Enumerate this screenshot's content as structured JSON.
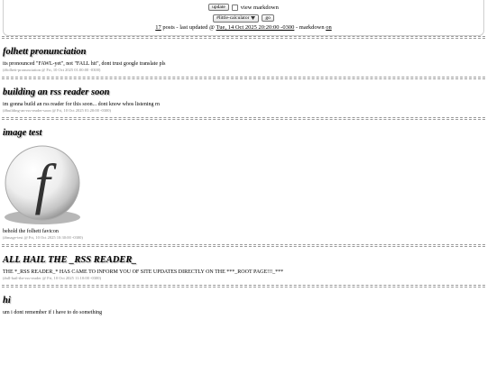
{
  "header": {
    "update_label": "update",
    "view_markdown_label": "view markdown",
    "view_markdown_checked": false,
    "channel_select": "#little-calculator",
    "go_label": "go",
    "status": {
      "post_count": "17",
      "posts_text": " posts - last updated @ ",
      "updated": "Tue, 14 Oct 2025 20:20:00 -0300",
      "markdown_text": " - markdown ",
      "markdown_state": "on"
    }
  },
  "posts": [
    {
      "title": "folhett pronunciation",
      "body": "its pronounced \"FAWL-yet\", not \"FALL hit\", dont trust google translate pls",
      "meta": "(#folhett-pronunciation @ Fri, 10 Oct 2025 01:00:00 -0300)"
    },
    {
      "title": "building an rss reader soon",
      "body": "im gonna build an rss reader for this soon... dont know whos listening rn",
      "meta": "(#building-an-rss-reader-soon @ Fri, 10 Oct 2025 01:20:00 -0300)"
    },
    {
      "title": "image test",
      "body": "behold the folhett favicon",
      "meta": "(#image-test @ Fri, 10 Oct 2025 10:30:00 -0300)",
      "image": {
        "icon": "folhett-favicon",
        "glyph": "f"
      }
    },
    {
      "title": "ALL HAIL THE _RSS READER_",
      "body": "THE *_RSS READER_* HAS CAME TO INFORM YOU OF SITE UPDATES DIRECTLY ON THE ***_ROOT PAGE!!!_***",
      "meta": "(#all-hail-the-rss-reader @ Fri, 10 Oct 2025 11:10:00 -0300)"
    },
    {
      "title": "hi",
      "body": "um i dont remember if i have to do something",
      "meta": ""
    }
  ]
}
